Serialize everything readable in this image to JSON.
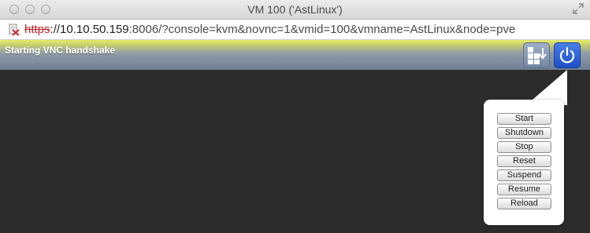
{
  "window": {
    "title": "VM 100 ('AstLinux')"
  },
  "urlbar": {
    "scheme": "https",
    "separator": "://",
    "host": "10.10.50.159",
    "rest": ":8006/?console=kvm&novnc=1&vmid=100&vmname=AstLinux&node=pve"
  },
  "vnc": {
    "status": "Starting VNC handshake",
    "send_keys_icon": "send-keys-icon",
    "power_icon": "power-icon"
  },
  "power_menu": {
    "buttons": [
      "Start",
      "Shutdown",
      "Stop",
      "Reset",
      "Suspend",
      "Resume",
      "Reload"
    ]
  },
  "colors": {
    "power_button": "#2a5fd6",
    "status_bar_top": "#e8ec6a",
    "status_bar_bottom": "#6f7f95",
    "canvas": "#2c2c2c",
    "insecure_scheme": "#c0262d"
  }
}
